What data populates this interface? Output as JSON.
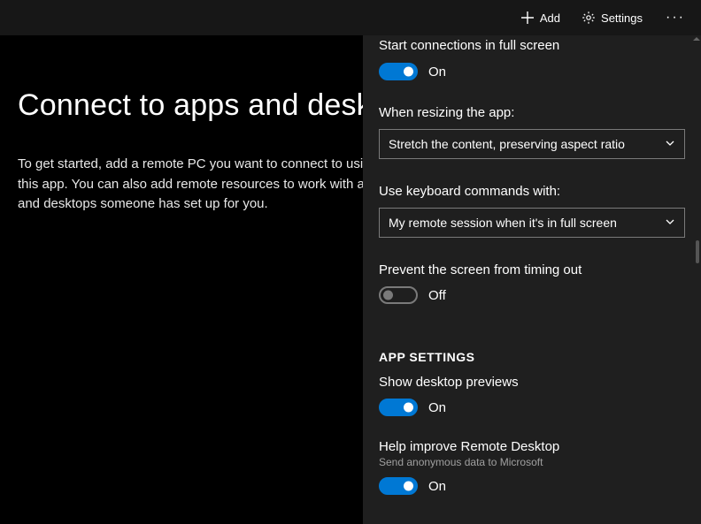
{
  "cmdbar": {
    "add_label": "Add",
    "settings_label": "Settings"
  },
  "main": {
    "title": "Connect to apps and desktops",
    "body": "To get started, add a remote PC you want to connect to using this app. You can also add remote resources to work with apps and desktops someone has set up for you."
  },
  "panel": {
    "cutoff_label": "Start connections in full screen",
    "full_screen_toggle": {
      "state": "On",
      "on": true
    },
    "resizing_label": "When resizing the app:",
    "resizing_value": "Stretch the content, preserving aspect ratio",
    "keyboard_label": "Use keyboard commands with:",
    "keyboard_value": "My remote session when it's in full screen",
    "prevent_timeout_label": "Prevent the screen from timing out",
    "prevent_timeout_toggle": {
      "state": "Off",
      "on": false
    },
    "section_header": "APP SETTINGS",
    "previews_label": "Show desktop previews",
    "previews_toggle": {
      "state": "On",
      "on": true
    },
    "help_label": "Help improve Remote Desktop",
    "help_subtext": "Send anonymous data to Microsoft",
    "help_toggle": {
      "state": "On",
      "on": true
    }
  }
}
